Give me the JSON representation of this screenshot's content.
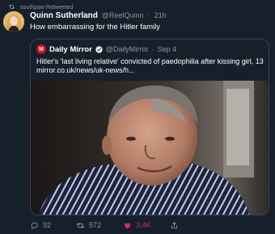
{
  "retweet_context": {
    "text": "southpaw Retweeted"
  },
  "tweet": {
    "display_name": "Quinn Sutherland",
    "handle": "@ReelQuinn",
    "separator": "·",
    "time": "21h",
    "text": "How embarrassing for the Hitler family"
  },
  "quoted_tweet": {
    "logo_letter": "M",
    "display_name": "Daily Mirror",
    "handle": "@DailyMirror",
    "separator": "·",
    "date": "Sep 4",
    "text_line1": "Hitler's 'last living relative' convicted of paedophilia after kissing girl, 13",
    "text_line2": "mirror.co.uk/news/uk-news/h..."
  },
  "actions": {
    "reply_count": "92",
    "retweet_count": "572",
    "like_count": "3.4K"
  },
  "colors": {
    "background": "#15202b",
    "primary_text": "#ffffff",
    "secondary_text": "#8899a6",
    "border": "#38444d",
    "like": "#e0245e",
    "verified": "#1da1f2",
    "mirror_red": "#cf1020"
  }
}
